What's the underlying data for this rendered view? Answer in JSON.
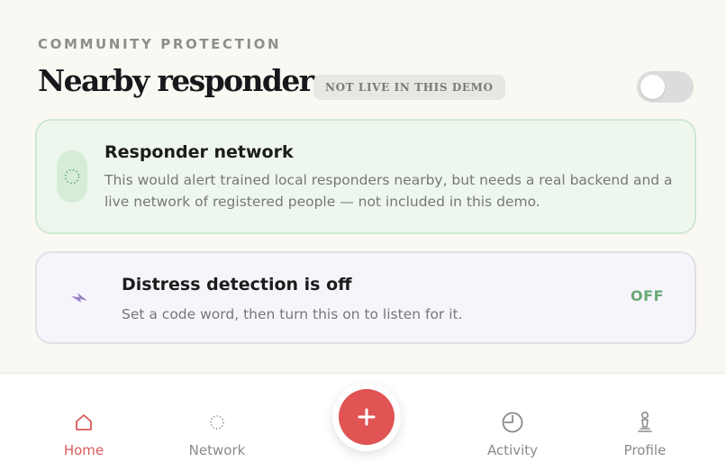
{
  "header": {
    "eyebrow": "COMMUNITY PROTECTION",
    "title": "Nearby responders",
    "badge": "NOT LIVE IN THIS DEMO",
    "toggle_on": false
  },
  "network_card": {
    "icon": "dotted-circle-icon",
    "title": "Responder network",
    "body": "This would alert trained local responders nearby, but needs a real backend and a live network of registered people — not included in this demo."
  },
  "distress_card": {
    "icon": "lightning-icon",
    "title": "Distress detection is off",
    "body": "Set a code word, then turn this on to listen for it.",
    "status": "OFF"
  },
  "nav": {
    "items": [
      {
        "label": "Home",
        "icon": "home-icon",
        "active": true
      },
      {
        "label": "Network",
        "icon": "dotted-circle-icon",
        "active": false
      },
      {
        "label": "Activity",
        "icon": "clock-icon",
        "active": false
      },
      {
        "label": "Profile",
        "icon": "profile-icon",
        "active": false
      }
    ],
    "fab_icon": "plus-icon"
  },
  "colors": {
    "accent": "#e05454",
    "success": "#6aa876",
    "background": "#faf8f2"
  }
}
